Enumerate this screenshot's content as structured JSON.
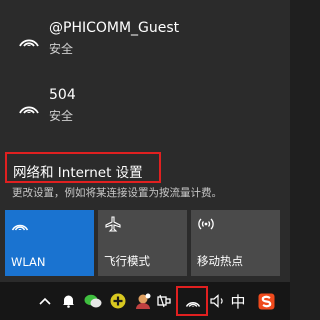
{
  "networks": [
    {
      "name": "@PHICOMM_Guest",
      "status": "安全",
      "icon": "wifi-icon"
    },
    {
      "name": "504",
      "status": "安全",
      "icon": "wifi-icon"
    }
  ],
  "settings": {
    "title": "网络和 Internet 设置",
    "subtitle": "更改设置，例如将某连接设置为按流量计费。"
  },
  "tiles": [
    {
      "label": "WLAN",
      "icon": "wifi-icon",
      "active": true
    },
    {
      "label": "飞行模式",
      "icon": "airplane-icon",
      "active": false
    },
    {
      "label": "移动热点",
      "icon": "hotspot-icon",
      "active": false
    }
  ],
  "taskbar": {
    "ime_label": "中",
    "icons": [
      "chevron-up-icon",
      "notification-bell-icon",
      "wechat-icon",
      "plus-app-icon",
      "user-avatar-icon",
      "usb-device-icon",
      "network-wifi-icon",
      "volume-icon",
      "sogou-icon"
    ]
  },
  "colors": {
    "accent": "#1a73d0",
    "highlight": "#e02020",
    "panel": "#2b2b2b",
    "tile_off": "#4a4a4a",
    "taskbar": "#161616"
  }
}
